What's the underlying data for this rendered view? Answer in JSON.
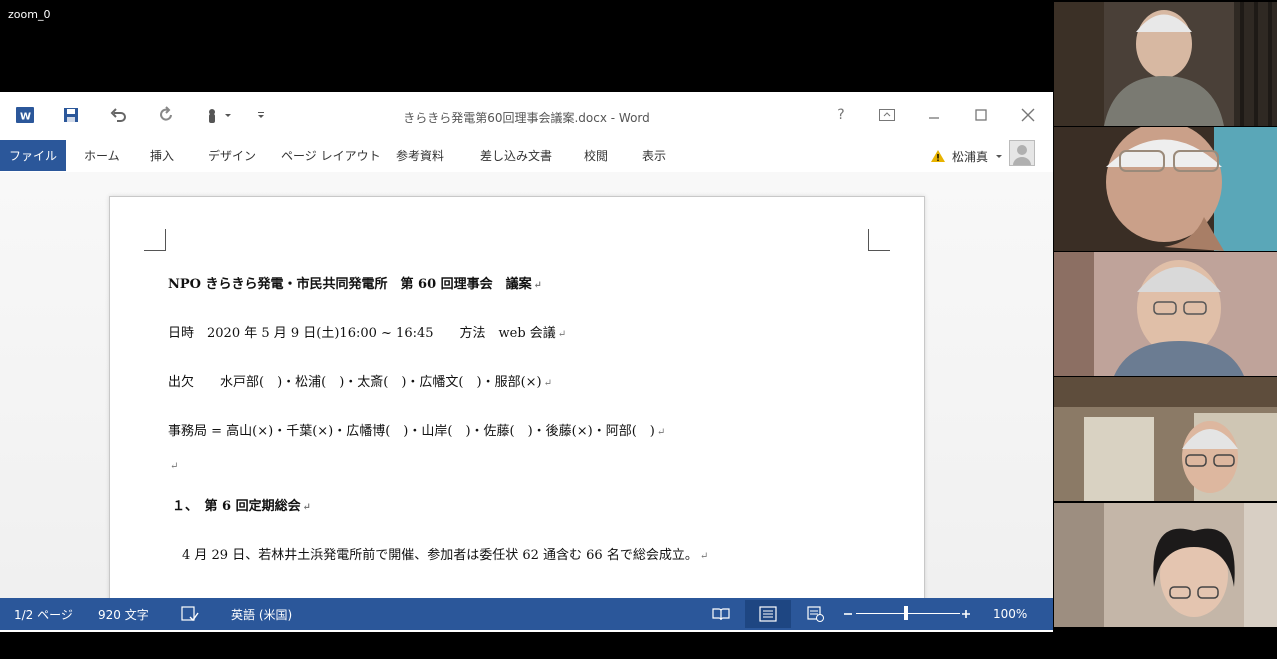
{
  "window_label": "zoom_0",
  "icons": {
    "gallery": "gallery-view-icon",
    "word_logo": "word-logo-icon",
    "save": "save-icon",
    "undo": "undo-icon",
    "redo": "redo-icon",
    "touch": "touch-mode-icon",
    "customize": "customize-qat-icon"
  },
  "word": {
    "title": "きらきら発電第60回理事会議案.docx - Word",
    "help": "?",
    "ribbon_display": "ribbon-display-icon",
    "tabs": [
      "ファイル",
      "ホーム",
      "挿入",
      "デザイン",
      "ページ レイアウト",
      "参考資料",
      "差し込み文書",
      "校閲",
      "表示"
    ],
    "user_name": "松浦真",
    "colors": {
      "accent": "#2b579a"
    }
  },
  "document": {
    "lines": [
      "NPO きらきら発電・市民共同発電所　第 60 回理事会　議案",
      "日時　2020 年 5 月 9 日(土)16:00 ~ 16:45　　方法　web 会議",
      "出欠　　水戸部(　)・松浦(　)・太斎(　)・広幡文(　)・服部(×)",
      "事務局 = 高山(×)・千葉(×)・広幡博(　)・山岸(　)・佐藤(　)・後藤(×)・阿部(　)",
      "",
      "１、　第 6 回定期総会",
      "4 月 29 日、若林井土浜発電所前で開催、参加者は委任状 62 通含む 66 名で総会成立。"
    ],
    "paragraph_mark": "↵"
  },
  "status": {
    "page": "1/2 ページ",
    "words": "920 文字",
    "language": "英語 (米国)",
    "zoom": "100%",
    "zoom_fraction": 0.5
  },
  "participants": [
    {
      "name": "participant-1",
      "bg": "#6b6155"
    },
    {
      "name": "participant-2",
      "bg": "#5a4a3e"
    },
    {
      "name": "participant-3",
      "bg": "#b99a8f"
    },
    {
      "name": "participant-4",
      "bg": "#7a6a5c"
    },
    {
      "name": "participant-5",
      "bg": "#b8a99a"
    }
  ]
}
